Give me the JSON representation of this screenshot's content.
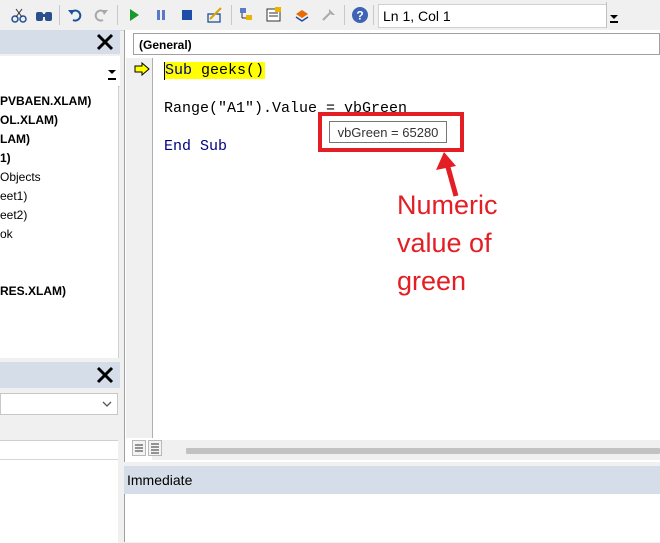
{
  "toolbar": {
    "icons": [
      "cut-icon",
      "find-icon",
      "undo-icon",
      "redo-icon",
      "run-icon",
      "break-icon",
      "reset-icon",
      "design-mode-icon",
      "project-explorer-icon",
      "properties-window-icon",
      "object-browser-icon",
      "toolbox-icon",
      "help-icon"
    ],
    "status": "Ln 1, Col 1"
  },
  "project_tree": [
    {
      "label": "PVBAEN.XLAM)",
      "bold": true
    },
    {
      "label": "OL.XLAM)",
      "bold": true
    },
    {
      "label": "LAM)",
      "bold": true
    },
    {
      "label": "1)",
      "bold": true
    },
    {
      "label": "Objects",
      "bold": false
    },
    {
      "label": "eet1)",
      "bold": false
    },
    {
      "label": "eet2)",
      "bold": false
    },
    {
      "label": "ok",
      "bold": false
    },
    {
      "label": "RES.XLAM)",
      "bold": true
    }
  ],
  "code_window": {
    "object_combo": "(General)",
    "lines": [
      "Sub geeks()",
      "Range(\"A1\").Value = vbGreen",
      "End Sub"
    ],
    "tooltip": "vbGreen = 65280",
    "colors": {
      "keyword": "#00007f",
      "highlight": "#ffff00",
      "text": "#000000"
    }
  },
  "annotation": {
    "lines": [
      "Numeric",
      "value of",
      "green"
    ],
    "color": "#e31e24"
  },
  "immediate": {
    "title": "Immediate"
  }
}
